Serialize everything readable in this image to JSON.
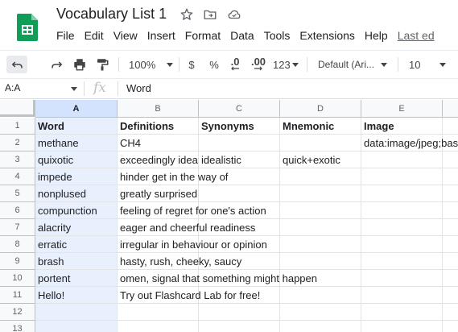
{
  "app": {
    "doc_title": "Vocabulary List 1",
    "menu": [
      "File",
      "Edit",
      "View",
      "Insert",
      "Format",
      "Data",
      "Tools",
      "Extensions",
      "Help",
      "Last ed"
    ],
    "title_icons": [
      "star-icon",
      "move-folder-icon",
      "cloud-status-icon"
    ]
  },
  "toolbar": {
    "zoom": "100%",
    "currency": "$",
    "percent": "%",
    "decrease_decimal": ".0",
    "increase_decimal": ".00",
    "more_formats": "123",
    "font_family": "Default (Ari...",
    "font_size": "10",
    "icons": [
      "undo-icon",
      "redo-icon",
      "print-icon",
      "paint-format-icon",
      "plus-icon"
    ]
  },
  "formula_bar": {
    "name_box": "A:A",
    "fx": "fx",
    "value": "Word"
  },
  "grid": {
    "columns": [
      "A",
      "B",
      "C",
      "D",
      "E"
    ],
    "selected_column": "A",
    "row_numbers": [
      "1",
      "2",
      "3",
      "4",
      "5",
      "6",
      "7",
      "8",
      "9",
      "10",
      "11",
      "12",
      "13"
    ],
    "rows": [
      [
        "Word",
        "Definitions",
        "Synonyms",
        "Mnemonic",
        "Image"
      ],
      [
        "methane",
        "CH4",
        "",
        "",
        "data:image/jpeg;bas"
      ],
      [
        "quixotic",
        "exceedingly idealistic",
        "idealistic",
        "quick+exotic",
        ""
      ],
      [
        "impede",
        "hinder get in the way of",
        "",
        "",
        ""
      ],
      [
        "nonplused",
        "greatly surprised",
        "",
        "",
        ""
      ],
      [
        "compunction",
        "feeling of regret for one's action",
        "",
        "",
        ""
      ],
      [
        "alacrity",
        "eager and cheerful readiness",
        "",
        "",
        ""
      ],
      [
        "erratic",
        "irregular in behaviour or opinion",
        "",
        "",
        ""
      ],
      [
        "brash",
        "hasty, rush, cheeky, saucy",
        "",
        "",
        ""
      ],
      [
        "portent",
        "omen, signal that something might happen",
        "",
        "",
        ""
      ],
      [
        "Hello!",
        "Try out Flashcard Lab for free!",
        "",
        "",
        ""
      ],
      [
        "",
        "",
        "",
        "",
        ""
      ],
      [
        "",
        "",
        "",
        "",
        ""
      ]
    ]
  },
  "colors": {
    "sheets_green": "#0f9d58",
    "selection_blue": "#1a73e8",
    "selected_fill": "#e8f0fe",
    "header_selected": "#d3e3fd"
  }
}
